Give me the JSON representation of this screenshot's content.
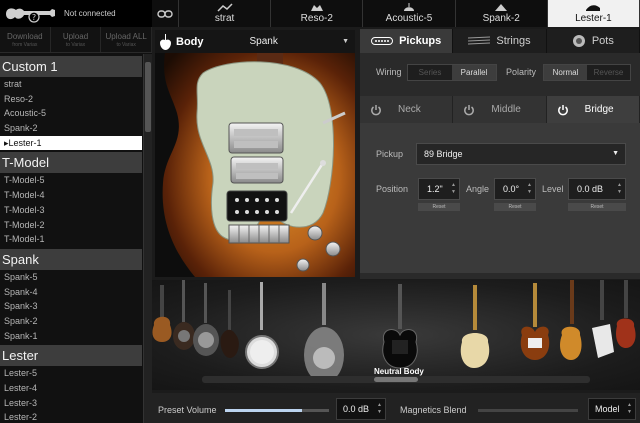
{
  "connection": {
    "status": "Not connected"
  },
  "toolbar": [
    {
      "label": "Download",
      "sub": "from Variax"
    },
    {
      "label": "Upload",
      "sub": "to Variax"
    },
    {
      "label": "Upload ALL",
      "sub": "to Variax"
    }
  ],
  "presets": [
    {
      "group": "Custom 1",
      "items": [
        "strat",
        "Reso-2",
        "Acoustic-5",
        "Spank-2",
        "Lester-1"
      ]
    },
    {
      "group": "T-Model",
      "items": [
        "T-Model-5",
        "T-Model-4",
        "T-Model-3",
        "T-Model-2",
        "T-Model-1"
      ]
    },
    {
      "group": "Spank",
      "items": [
        "Spank-5",
        "Spank-4",
        "Spank-3",
        "Spank-2",
        "Spank-1"
      ]
    },
    {
      "group": "Lester",
      "items": [
        "Lester-5",
        "Lester-4",
        "Lester-3",
        "Lester-2"
      ]
    }
  ],
  "selected_preset": "Lester-1",
  "selected_marker": "▸",
  "tabs": [
    "strat",
    "Reso-2",
    "Acoustic-5",
    "Spank-2",
    "Lester-1"
  ],
  "active_tab": "Lester-1",
  "body": {
    "label": "Body",
    "value": "Spank"
  },
  "subtabs": [
    {
      "label": "Pickups",
      "icon": "pickup-icon"
    },
    {
      "label": "Strings",
      "icon": "strings-icon"
    },
    {
      "label": "Pots",
      "icon": "knob-icon"
    }
  ],
  "active_subtab": "Pickups",
  "wiring": {
    "label": "Wiring",
    "options": [
      "Series",
      "Parallel"
    ],
    "selected": "Parallel"
  },
  "polarity": {
    "label": "Polarity",
    "options": [
      "Normal",
      "Reverse"
    ],
    "selected": "Normal"
  },
  "positions": [
    "Neck",
    "Middle",
    "Bridge"
  ],
  "active_position": "Bridge",
  "pickup": {
    "label": "Pickup",
    "value": "89 Bridge"
  },
  "position": {
    "label": "Position",
    "value": "1.2\""
  },
  "angle": {
    "label": "Angle",
    "value": "0.0°"
  },
  "level": {
    "label": "Level",
    "value": "0.0 dB"
  },
  "reset_label": "Reset",
  "strip": {
    "selected_label": "Neutral Body"
  },
  "bottom": {
    "preset_volume_label": "Preset Volume",
    "preset_volume": "0.0 dB",
    "preset_volume_fraction": 0.74,
    "magnetics_label": "Magnetics Blend",
    "magnetics_value": "Model",
    "magnetics_fraction": 0.0
  },
  "colors": {
    "active_tab_bg": "#f1f1f1",
    "sunburst_outer": "#1c0c04",
    "sunburst_mid": "#8a3d0f",
    "sunburst_center": "#e0962a",
    "pickguard": "#c9d4bc",
    "volume_fill": "#bcd4ef"
  }
}
